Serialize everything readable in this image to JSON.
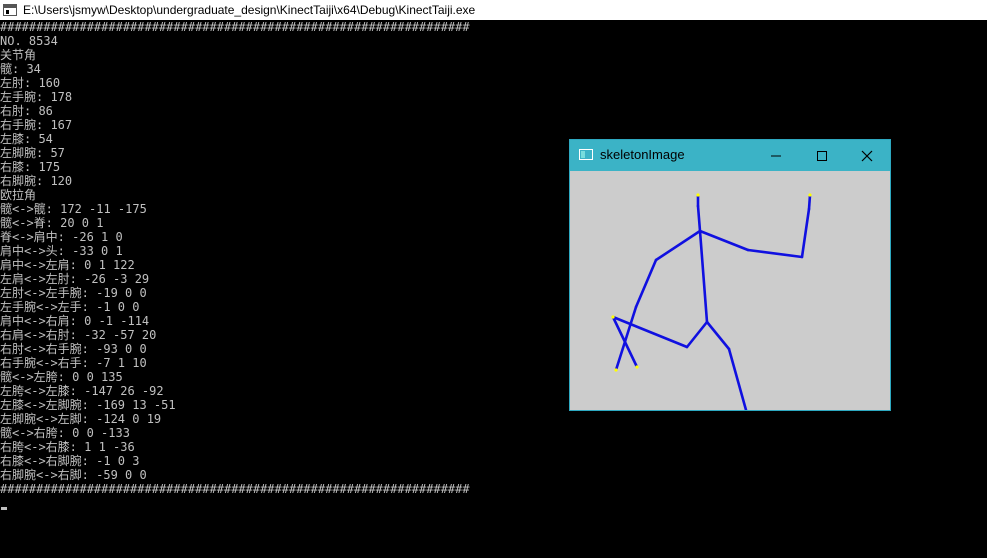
{
  "console": {
    "title": "E:\\Users\\jsmyw\\Desktop\\undergraduate_design\\KinectTaiji\\x64\\Debug\\KinectTaiji.exe",
    "lines": [
      "#################################################################",
      "NO. 8534",
      "关节角",
      "髋: 34",
      "左肘: 160",
      "左手腕: 178",
      "右肘: 86",
      "右手腕: 167",
      "左膝: 54",
      "左脚腕: 57",
      "右膝: 175",
      "右脚腕: 120",
      "欧拉角",
      "髋<->髋: 172 -11 -175",
      "髋<->脊: 20 0 1",
      "脊<->肩中: -26 1 0",
      "肩中<->头: -33 0 1",
      "肩中<->左肩: 0 1 122",
      "左肩<->左肘: -26 -3 29",
      "左肘<->左手腕: -19 0 0",
      "左手腕<->左手: -1 0 0",
      "肩中<->右肩: 0 -1 -114",
      "右肩<->右肘: -32 -57 20",
      "右肘<->右手腕: -93 0 0",
      "右手腕<->右手: -7 1 10",
      "髋<->左胯: 0 0 135",
      "左胯<->左膝: -147 26 -92",
      "左膝<->左脚腕: -169 13 -51",
      "左脚腕<->左脚: -124 0 19",
      "髋<->右胯: 0 0 -133",
      "右胯<->右膝: 1 1 -36",
      "右膝<->右脚腕: -1 0 3",
      "右脚腕<->右脚: -59 0 0",
      "#################################################################"
    ]
  },
  "skeleton_window": {
    "title": "skeletonImage",
    "minimize_glyph": "—",
    "maximize_glyph": "☐",
    "close_glyph": "✕",
    "bone_color": "#1010e0",
    "joint_color": "#ffff00",
    "canvas_color": "#cccccc",
    "titlebar_color": "#3bb3c6"
  },
  "icons": {
    "console_app": "console-app-icon",
    "skeleton_window": "window-app-icon"
  }
}
